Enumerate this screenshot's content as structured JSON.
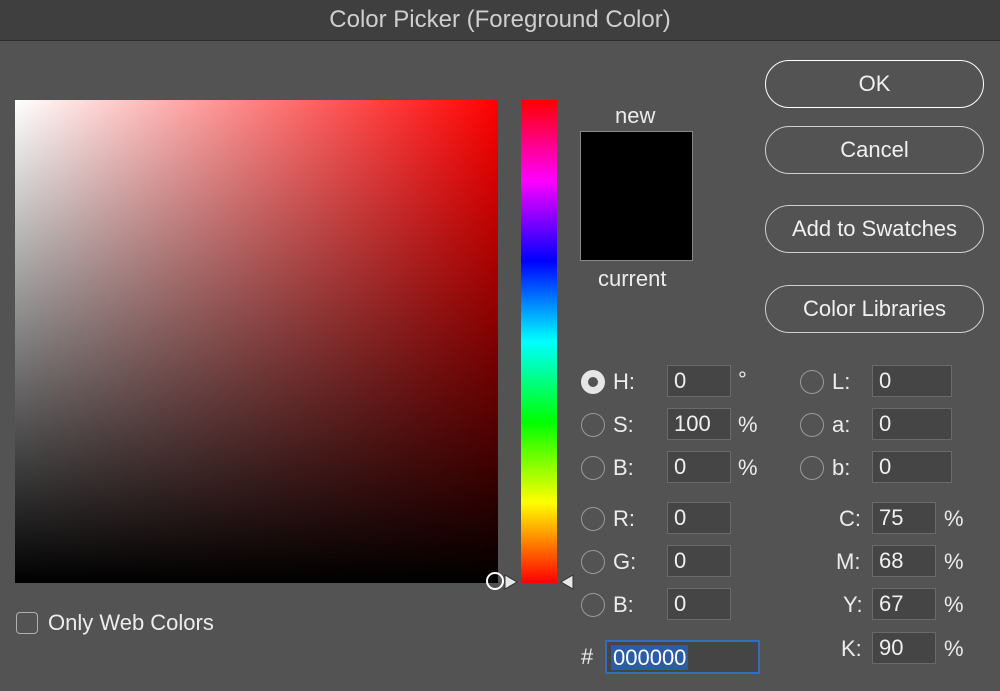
{
  "window": {
    "title": "Color Picker (Foreground Color)"
  },
  "swatch": {
    "new_label": "new",
    "current_label": "current",
    "new_color": "#000000",
    "current_color": "#000000"
  },
  "buttons": {
    "ok": "OK",
    "cancel": "Cancel",
    "add_swatches": "Add to Swatches",
    "color_libraries": "Color Libraries"
  },
  "hsb": {
    "h": {
      "label": "H:",
      "value": "0",
      "unit": "°",
      "selected": true
    },
    "s": {
      "label": "S:",
      "value": "100",
      "unit": "%"
    },
    "b": {
      "label": "B:",
      "value": "0",
      "unit": "%"
    }
  },
  "rgb": {
    "r": {
      "label": "R:",
      "value": "0"
    },
    "g": {
      "label": "G:",
      "value": "0"
    },
    "b": {
      "label": "B:",
      "value": "0"
    }
  },
  "lab": {
    "l": {
      "label": "L:",
      "value": "0"
    },
    "a": {
      "label": "a:",
      "value": "0"
    },
    "b": {
      "label": "b:",
      "value": "0"
    }
  },
  "cmyk": {
    "c": {
      "label": "C:",
      "value": "75",
      "unit": "%"
    },
    "m": {
      "label": "M:",
      "value": "68",
      "unit": "%"
    },
    "y": {
      "label": "Y:",
      "value": "67",
      "unit": "%"
    },
    "k": {
      "label": "K:",
      "value": "90",
      "unit": "%"
    }
  },
  "hex": {
    "prefix": "#",
    "value": "000000"
  },
  "only_web_colors": {
    "label": "Only Web Colors",
    "checked": false
  },
  "colors": {
    "hue_base": "#ff0000",
    "selection": "#2b5da6"
  }
}
